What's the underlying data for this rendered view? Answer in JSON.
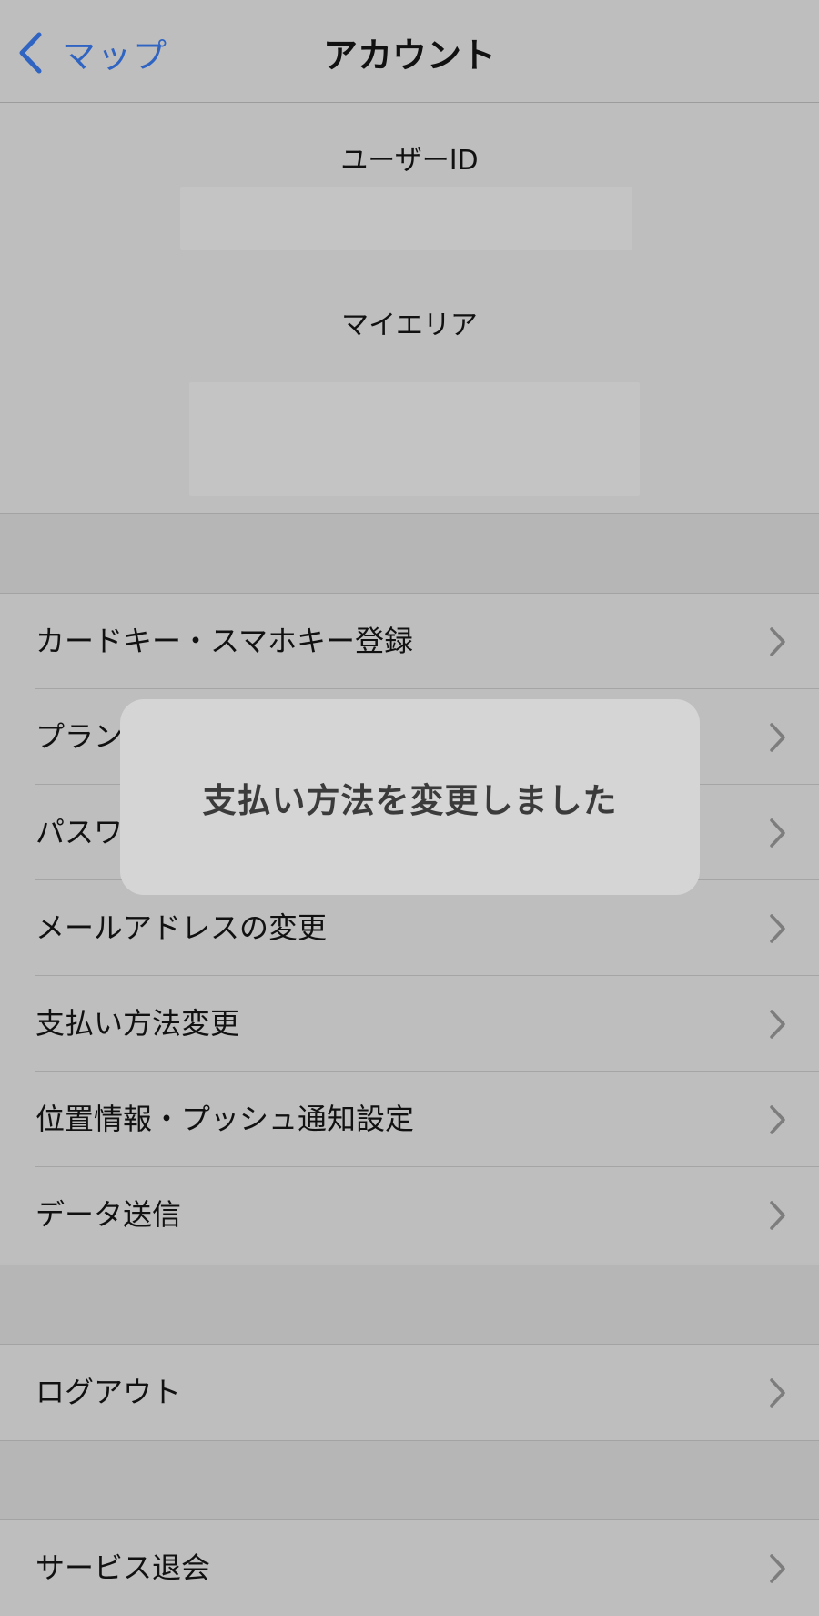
{
  "navbar": {
    "back_label": "マップ",
    "title": "アカウント"
  },
  "user_id": {
    "label": "ユーザーID",
    "value": ""
  },
  "my_area": {
    "label": "マイエリア",
    "value": ""
  },
  "menu": {
    "items": [
      {
        "label": "カードキー・スマホキー登録"
      },
      {
        "label": "プラン"
      },
      {
        "label": "パスワ"
      },
      {
        "label": "メールアドレスの変更"
      },
      {
        "label": "支払い方法変更"
      },
      {
        "label": "位置情報・プッシュ通知設定"
      },
      {
        "label": "データ送信"
      }
    ]
  },
  "logout": {
    "label": "ログアウト"
  },
  "withdraw": {
    "label": "サービス退会"
  },
  "toast": {
    "message": "支払い方法を変更しました"
  },
  "icons": {
    "back": "chevron-left-icon",
    "row": "chevron-right-icon"
  },
  "colors": {
    "accent": "#2f64c3",
    "background": "#bdbdbd",
    "toast_background": "#d5d5d5"
  }
}
